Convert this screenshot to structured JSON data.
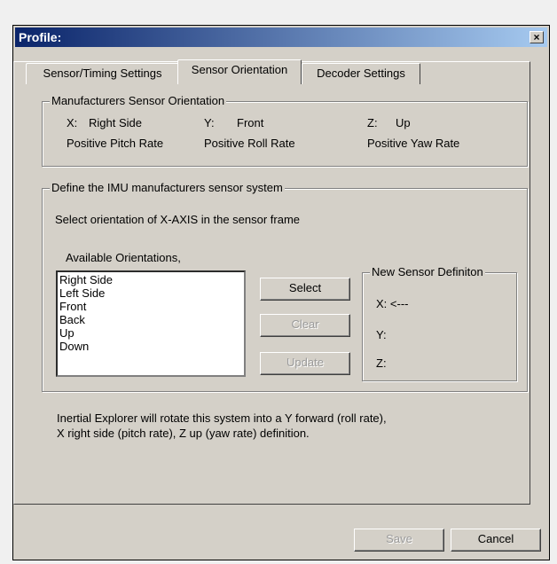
{
  "window": {
    "title": "Profile:",
    "close_label": "×"
  },
  "tabs": [
    {
      "label": "Sensor/Timing Settings"
    },
    {
      "label": "Sensor Orientation"
    },
    {
      "label": "Decoder Settings"
    }
  ],
  "manufacturers_group": {
    "legend": "Manufacturers Sensor Orientation",
    "x_label": "X:",
    "x_value": "Right Side",
    "y_label": "Y:",
    "y_value": "Front",
    "z_label": "Z:",
    "z_value": "Up",
    "pitch": "Positive Pitch Rate",
    "roll": "Positive Roll Rate",
    "yaw": "Positive Yaw Rate"
  },
  "define_group": {
    "legend": "Define the IMU manufacturers sensor system",
    "instruction": "Select orientation of X-AXIS in the sensor frame",
    "available_label": "Available Orientations,",
    "orientations": [
      "Right Side",
      "Left Side",
      "Front",
      "Back",
      "Up",
      "Down"
    ],
    "select_label": "Select",
    "clear_label": "Clear",
    "update_label": "Update",
    "new_sensor": {
      "legend": "New Sensor Definiton",
      "x": "X: <---",
      "y": "Y:",
      "z": "Z:"
    }
  },
  "note_line1": "Inertial Explorer will rotate this system into a Y forward (roll rate),",
  "note_line2": "X right side (pitch rate), Z up (yaw rate) definition.",
  "footer": {
    "save_label": "Save",
    "cancel_label": "Cancel"
  }
}
